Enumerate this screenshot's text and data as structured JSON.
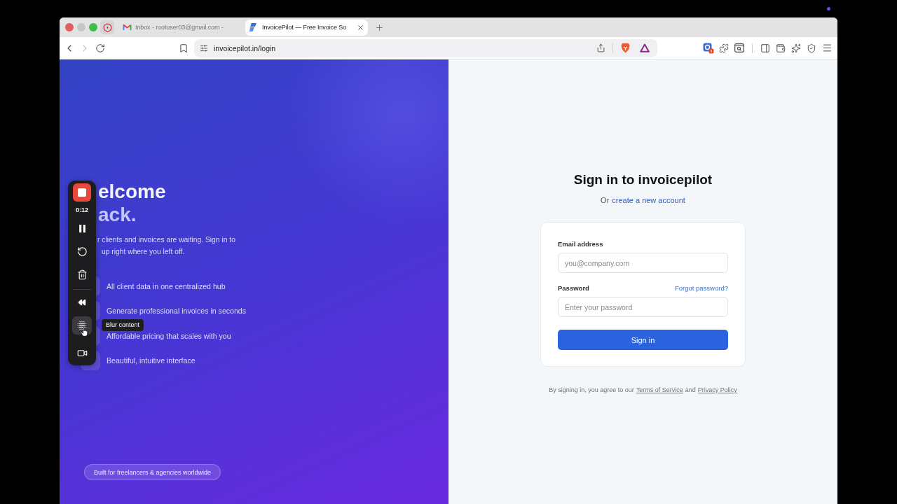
{
  "browser": {
    "tabs": [
      {
        "kind": "mail",
        "title": "Inbox - rootuser03@gmail.com -",
        "selected": false
      },
      {
        "kind": "app",
        "title": "InvoicePilot — Free Invoice So",
        "selected": true
      }
    ],
    "nav": [
      {
        "kind": "back",
        "disabled": false
      },
      {
        "kind": "forward",
        "disabled": true
      },
      {
        "kind": "reload",
        "disabled": false
      }
    ],
    "url": "invoicepilot.in/login"
  },
  "recorder": {
    "time": "0:12",
    "tools": [
      {
        "kind": "pause",
        "hovered": false
      },
      {
        "kind": "restart",
        "hovered": false
      },
      {
        "kind": "delete",
        "hovered": false
      },
      {
        "kind": "rewind",
        "hovered": false
      },
      {
        "kind": "blur",
        "hovered": true
      },
      {
        "kind": "camera",
        "hovered": false
      }
    ],
    "tooltip": "Blur content"
  },
  "hero": {
    "heading": [
      "elcome",
      "ack."
    ],
    "intro": [
      "r clients and invoices are waiting. Sign in to",
      "up right where you left off."
    ],
    "features": [
      "All client data in one centralized hub",
      "Generate professional invoices in seconds",
      "Affordable pricing that scales with you",
      "Beautiful, intuitive interface"
    ],
    "badge": "Built for freelancers & agencies worldwide"
  },
  "signin": {
    "title": "Sign in to invoicepilot",
    "prompt": "Or",
    "create_link": "create a new account",
    "email": {
      "label": "Email address",
      "placeholder": "you@company.com"
    },
    "password": {
      "label": "Password",
      "placeholder": "Enter your password",
      "forgot_link": "Forgot password?"
    },
    "submit": "Sign in",
    "legal": {
      "before": "By signing in, you agree to our",
      "terms": "Terms of Service",
      "between": "and",
      "privacy": "Privacy Policy"
    }
  }
}
